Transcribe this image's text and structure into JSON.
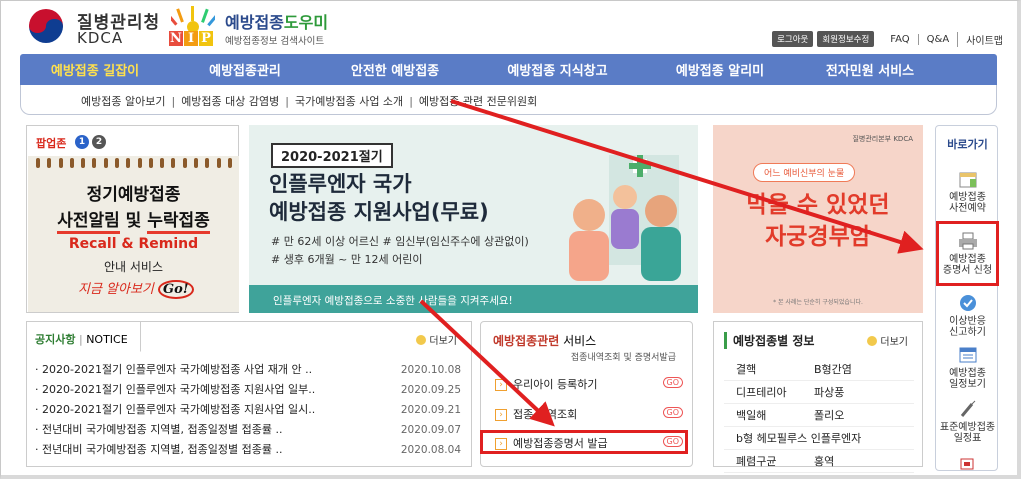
{
  "header": {
    "kdca_ko": "질병관리청",
    "kdca_en": "KDCA",
    "nip_letters": [
      "N",
      "I",
      "P"
    ],
    "site_title_blue": "예방접종",
    "site_title_green": "도우미",
    "site_subtitle": "예방접종정보 검색사이트",
    "util": {
      "logout": "로그아웃",
      "edit_info": "회원정보수정",
      "faq": "FAQ",
      "qa": "Q&A",
      "sitemap": "사이트맵"
    }
  },
  "nav": {
    "items": [
      "예방접종 길잡이",
      "예방접종관리",
      "안전한 예방접종",
      "예방접종 지식창고",
      "예방접종 알리미",
      "전자민원 서비스"
    ],
    "active_index": 0
  },
  "subnav": {
    "items": [
      "예방접종 알아보기",
      "예방접종 대상 감염병",
      "국가예방접종 사업 소개",
      "예방접종 관련 전문위원회"
    ]
  },
  "popup": {
    "title": "팝업존",
    "pages": [
      "1",
      "2"
    ],
    "line1": "정기예방접종",
    "line2a": "사전알림",
    "line2b": "및",
    "line2c": "누락접종",
    "recall": "Recall & Remind",
    "guide": "안내 서비스",
    "gonow": "지금 알아보기",
    "go": "Go!"
  },
  "banner": {
    "year": "2020-2021절기",
    "h1_line1": "인플루엔자 국가",
    "h1_line2": "예방접종 지원사업(무료)",
    "t1": "# 만 62세 이상 어르신  # 임신부(임신주수에 상관없이)",
    "t2": "# 생후 6개월 ~ 만 12세 어린이",
    "foot": "인플루엔자 예방접종으로 소중한 사람들을 지켜주세요!"
  },
  "promo": {
    "logo": "질병관리본부 KDCA",
    "pill": "어느 예비신부의 눈물",
    "big1": "막을 수 있었던",
    "big2": "자궁경부암",
    "small": "* 본 사례는 단순히 구성되었습니다."
  },
  "quick": {
    "title": "바로가기",
    "items": [
      {
        "label1": "예방접종",
        "label2": "사전예약",
        "icon": "calendar-icon"
      },
      {
        "label1": "예방접종",
        "label2": "증명서 신청",
        "icon": "printer-icon"
      },
      {
        "label1": "이상반응",
        "label2": "신고하기",
        "icon": "check-badge-icon"
      },
      {
        "label1": "예방접종",
        "label2": "일정보기",
        "icon": "schedule-icon"
      },
      {
        "label1": "표준예방접종",
        "label2": "일정표",
        "icon": "syringe-icon"
      }
    ]
  },
  "notice": {
    "tab_ko": "공지사항",
    "tab_en": "NOTICE",
    "more": "더보기",
    "rows": [
      {
        "title": "2020-2021절기 인플루엔자 국가예방접종 사업 재개 안 ..",
        "date": "2020.10.08"
      },
      {
        "title": "2020-2021절기 인플루엔자 국가예방접종 지원사업 일부..",
        "date": "2020.09.25"
      },
      {
        "title": "2020-2021절기 인플루엔자 국가예방접종 지원사업 일시..",
        "date": "2020.09.21"
      },
      {
        "title": "전년대비 국가예방접종 지역별, 접종일정별 접종률 ..",
        "date": "2020.09.07"
      },
      {
        "title": "전년대비 국가예방접종 지역별, 접종일정별 접종률 ..",
        "date": "2020.08.04"
      }
    ]
  },
  "service": {
    "title_red": "예방접종관련",
    "title_rest": " 서비스",
    "sub": "접종내역조회 및 증명서발급",
    "rows": [
      {
        "label": "우리아이 등록하기",
        "go": "GO"
      },
      {
        "label": "접종 내역조회",
        "go": "GO"
      },
      {
        "label": "예방접종증명서 발급",
        "go": "GO"
      }
    ]
  },
  "vinfo": {
    "title": "예방접종별 정보",
    "more": "더보기",
    "rows": [
      [
        "결핵",
        "B형간염"
      ],
      [
        "디프테리아",
        "파상풍"
      ],
      [
        "백일해",
        "폴리오"
      ],
      [
        "b형 헤모필루스 인플루엔자"
      ],
      [
        "폐렴구균",
        "홍역"
      ]
    ]
  },
  "colors": {
    "nav_bg": "#5a7cc6",
    "nav_active": "#ffe14d",
    "highlight": "#e02020",
    "banner_foot": "#3fa39a"
  }
}
